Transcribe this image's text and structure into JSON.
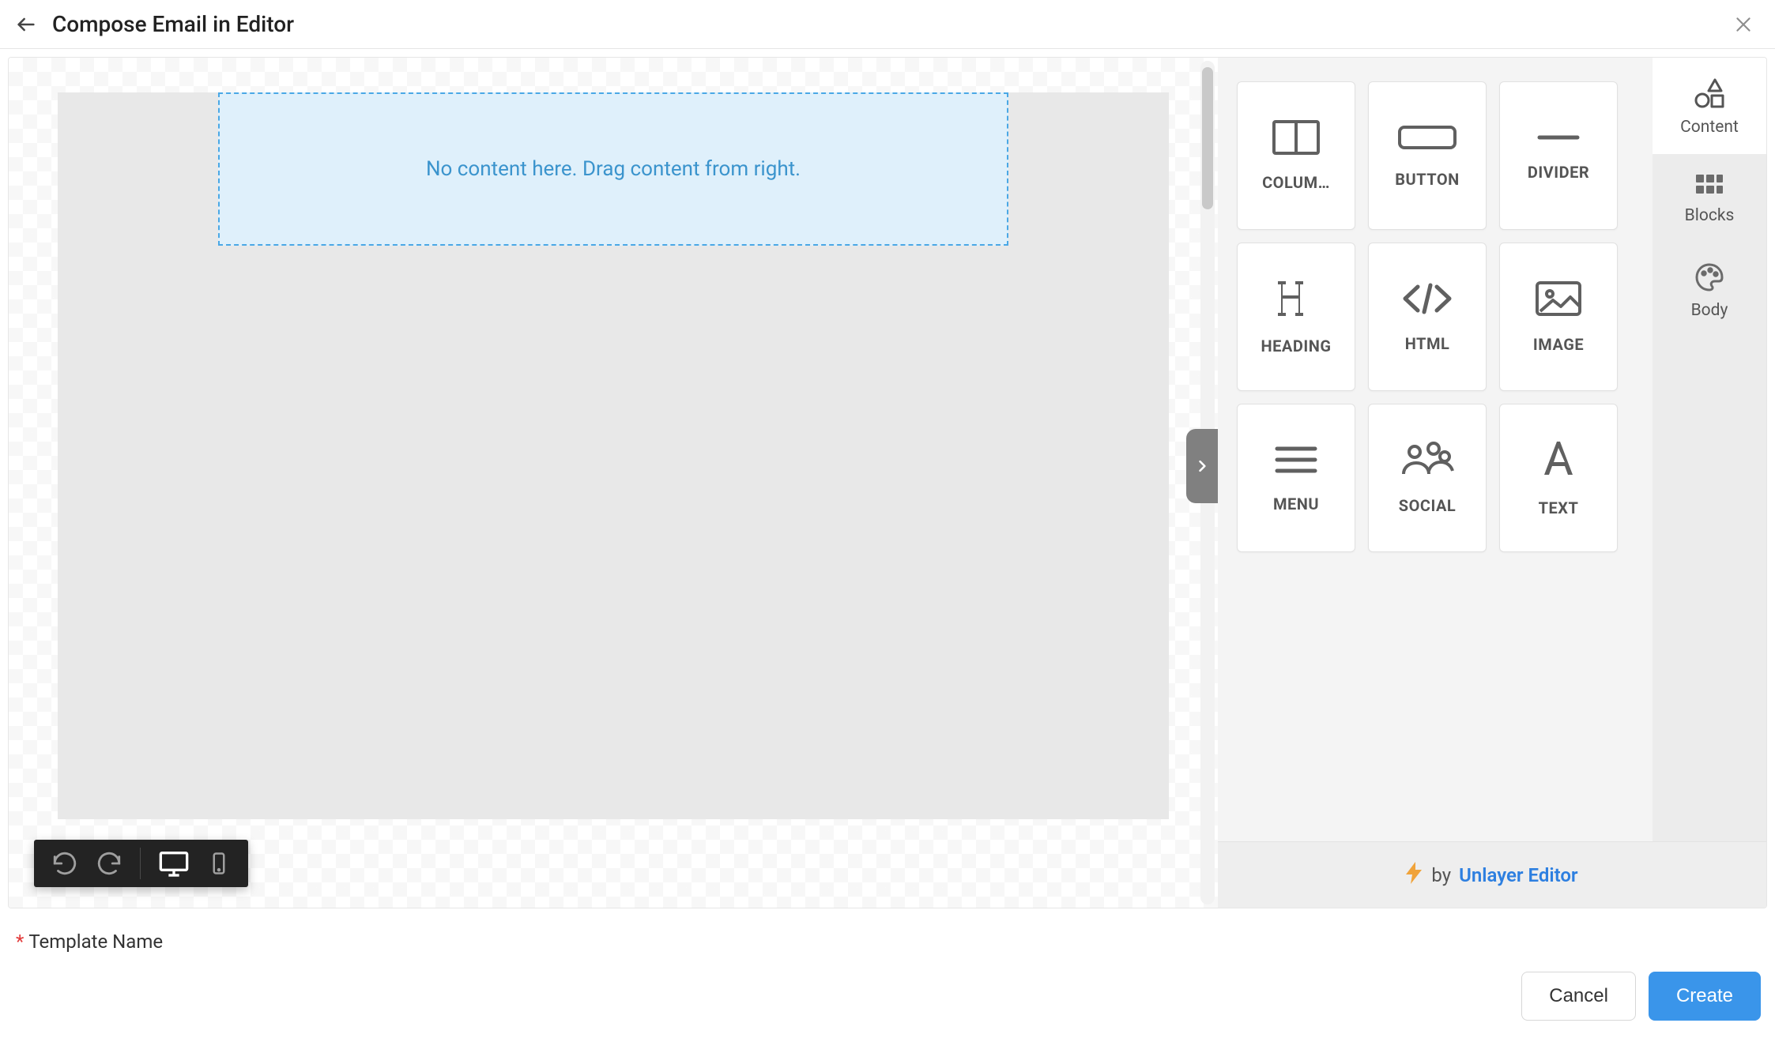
{
  "header": {
    "title": "Compose Email in Editor"
  },
  "canvas": {
    "dropzone_text": "No content here. Drag content from right."
  },
  "blocks": [
    {
      "key": "columns",
      "label": "COLUM…",
      "icon": "columns"
    },
    {
      "key": "button",
      "label": "BUTTON",
      "icon": "button"
    },
    {
      "key": "divider",
      "label": "DIVIDER",
      "icon": "divider"
    },
    {
      "key": "heading",
      "label": "HEADING",
      "icon": "heading"
    },
    {
      "key": "html",
      "label": "HTML",
      "icon": "html"
    },
    {
      "key": "image",
      "label": "IMAGE",
      "icon": "image"
    },
    {
      "key": "menu",
      "label": "MENU",
      "icon": "menu"
    },
    {
      "key": "social",
      "label": "SOCIAL",
      "icon": "social"
    },
    {
      "key": "text",
      "label": "TEXT",
      "icon": "text"
    }
  ],
  "side_tabs": {
    "content": "Content",
    "blocks": "Blocks",
    "body": "Body"
  },
  "attribution": {
    "by": "by",
    "vendor": "Unlayer Editor"
  },
  "form": {
    "template_label": "Template Name"
  },
  "footer": {
    "cancel": "Cancel",
    "create": "Create"
  }
}
